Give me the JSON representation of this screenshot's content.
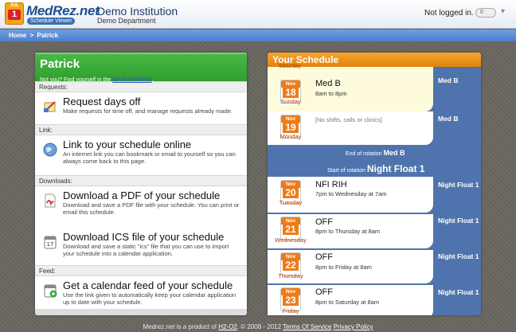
{
  "header": {
    "logo_badge_top": "JUL",
    "logo_badge_num": "1",
    "brand": "MedRez.net",
    "brand_sub": "Schedule Viewer",
    "institution": "Demo Institution",
    "department": "Demo Department",
    "login_status": "Not logged in.",
    "toggle_label": "0"
  },
  "breadcrumb": {
    "home": "Home",
    "separator": ">",
    "current": "Patrick"
  },
  "profile": {
    "name": "Patrick",
    "prompt": "Not you? Find yourself in the",
    "link": "list of Residents",
    "prompt_end": "."
  },
  "sections": {
    "requests": "Requests:",
    "link": "Link:",
    "downloads": "Downloads:",
    "feed": "Feed:"
  },
  "actions": {
    "request_off": {
      "title": "Request days off",
      "desc": "Make requests for time off, and manage requests already made.",
      "icon": "request-form-icon"
    },
    "link_online": {
      "title": "Link to your schedule online",
      "desc": "An internet link you can bookmark or email to yourself so you can always come back to this page.",
      "icon": "globe-icon"
    },
    "download_pdf": {
      "title": "Download a PDF of your schedule",
      "desc": "Download and save a PDF file with your schedule. You can print or email this schedule.",
      "icon": "pdf-icon"
    },
    "download_ics": {
      "title": "Download ICS file of your schedule",
      "desc": "Download and save a static \"ics\" file that you can use to import your schedule into a calendar application.",
      "icon": "calendar-file-icon"
    },
    "calendar_feed": {
      "title": "Get a calendar feed of your schedule",
      "desc": "Use the link given to automatically keep your calendar application up to date with your schedule.",
      "icon": "calendar-feed-icon"
    }
  },
  "schedule": {
    "title": "Your Schedule",
    "partial_top_label": "Saturday",
    "days": [
      {
        "month": "Nov",
        "day": "18",
        "weekday": "Sunday",
        "shift": "Med B",
        "time": "8am to 8pm",
        "rotation": "Med B",
        "highlight": true
      },
      {
        "month": "Nov",
        "day": "19",
        "weekday": "Monday",
        "shift": "",
        "time": "",
        "empty": "[No shifts, calls or clinics]",
        "rotation": "Med B"
      },
      {
        "month": "Nov",
        "day": "20",
        "weekday": "Tuesday",
        "shift": "NFI RIH",
        "time": "7pm to Wednesday at 7am",
        "rotation": "Night Float 1"
      },
      {
        "month": "Nov",
        "day": "21",
        "weekday": "Wednesday",
        "shift": "OFF",
        "time": "8pm to Thursday at 8am",
        "rotation": "Night Float 1"
      },
      {
        "month": "Nov",
        "day": "22",
        "weekday": "Thursday",
        "shift": "OFF",
        "time": "8pm to Friday at 8am",
        "rotation": "Night Float 1"
      },
      {
        "month": "Nov",
        "day": "23",
        "weekday": "Friday",
        "shift": "OFF",
        "time": "8pm to Saturday at 8am",
        "rotation": "Night Float 1"
      }
    ],
    "end_rotation_prefix": "End of rotation",
    "end_rotation_name": "Med B",
    "start_rotation_prefix": "Start of rotation",
    "start_rotation_name": "Night Float 1"
  },
  "footer": {
    "text1": "Medrez.net is a product of",
    "company": "H2-O2",
    "text2": ". © 2008 - 2012",
    "terms": "Terms Of Service",
    "privacy": "Privacy Policy"
  },
  "colors": {
    "green_header": "#2e9e2b",
    "orange_header": "#e0830c",
    "blue_panel": "#4f74ad",
    "calendar_orange": "#ef7b17",
    "highlight_day": "#fdfbdc"
  }
}
